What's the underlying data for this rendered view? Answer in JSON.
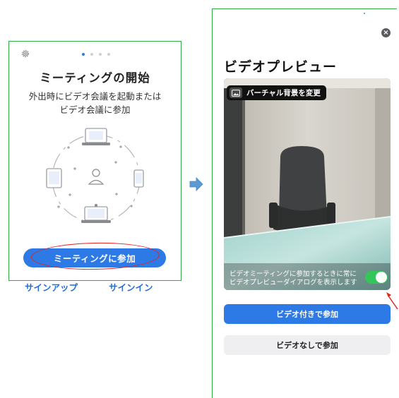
{
  "left_screen": {
    "title": "ミーティングの開始",
    "subtitle_line1": "外出時にビデオ会議を起動または",
    "subtitle_line2": "ビデオ会議に参加",
    "join_button": "ミーティングに参加",
    "signup_link": "サインアップ",
    "signin_link": "サインイン",
    "icons": [
      "gear-icon",
      "page-dots-indicator"
    ]
  },
  "right_screen": {
    "title": "ビデオプレビュー",
    "virtual_background_label": "バーチャル背景を変更",
    "toggle_text_line1": "ビデオミーティングに参加するときに常に",
    "toggle_text_line2": "ビデオプレビューダイアログを表示します",
    "toggle_on": true,
    "join_with_video_button": "ビデオ付きで参加",
    "join_without_video_button": "ビデオなしで参加",
    "icons": [
      "close-icon",
      "virtual-background-icon"
    ]
  },
  "colors": {
    "accent_blue": "#2d7ae6",
    "frame_green": "#2eaa48",
    "highlight_red": "#e0231b",
    "toggle_green": "#33c659"
  }
}
